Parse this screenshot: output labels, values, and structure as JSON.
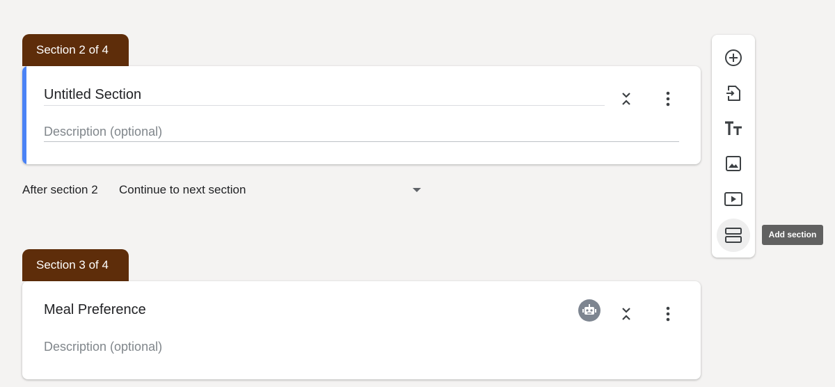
{
  "sections": [
    {
      "tab_label": "Section 2 of 4",
      "title": "Untitled Section",
      "description_placeholder": "Description (optional)"
    },
    {
      "tab_label": "Section 3 of 4",
      "title": "Meal Preference",
      "description_placeholder": "Description (optional)"
    }
  ],
  "after_section": {
    "label": "After section 2",
    "selected": "Continue to next section"
  },
  "toolbar": {
    "buttons": [
      {
        "icon": "add-circle-icon"
      },
      {
        "icon": "import-icon"
      },
      {
        "icon": "title-text-icon"
      },
      {
        "icon": "image-icon"
      },
      {
        "icon": "video-icon"
      },
      {
        "icon": "section-icon"
      }
    ],
    "tooltip": "Add section"
  },
  "colors": {
    "section_tab": "#5e2d0a",
    "accent": "#4a82f5",
    "background": "#f4f3f2"
  }
}
